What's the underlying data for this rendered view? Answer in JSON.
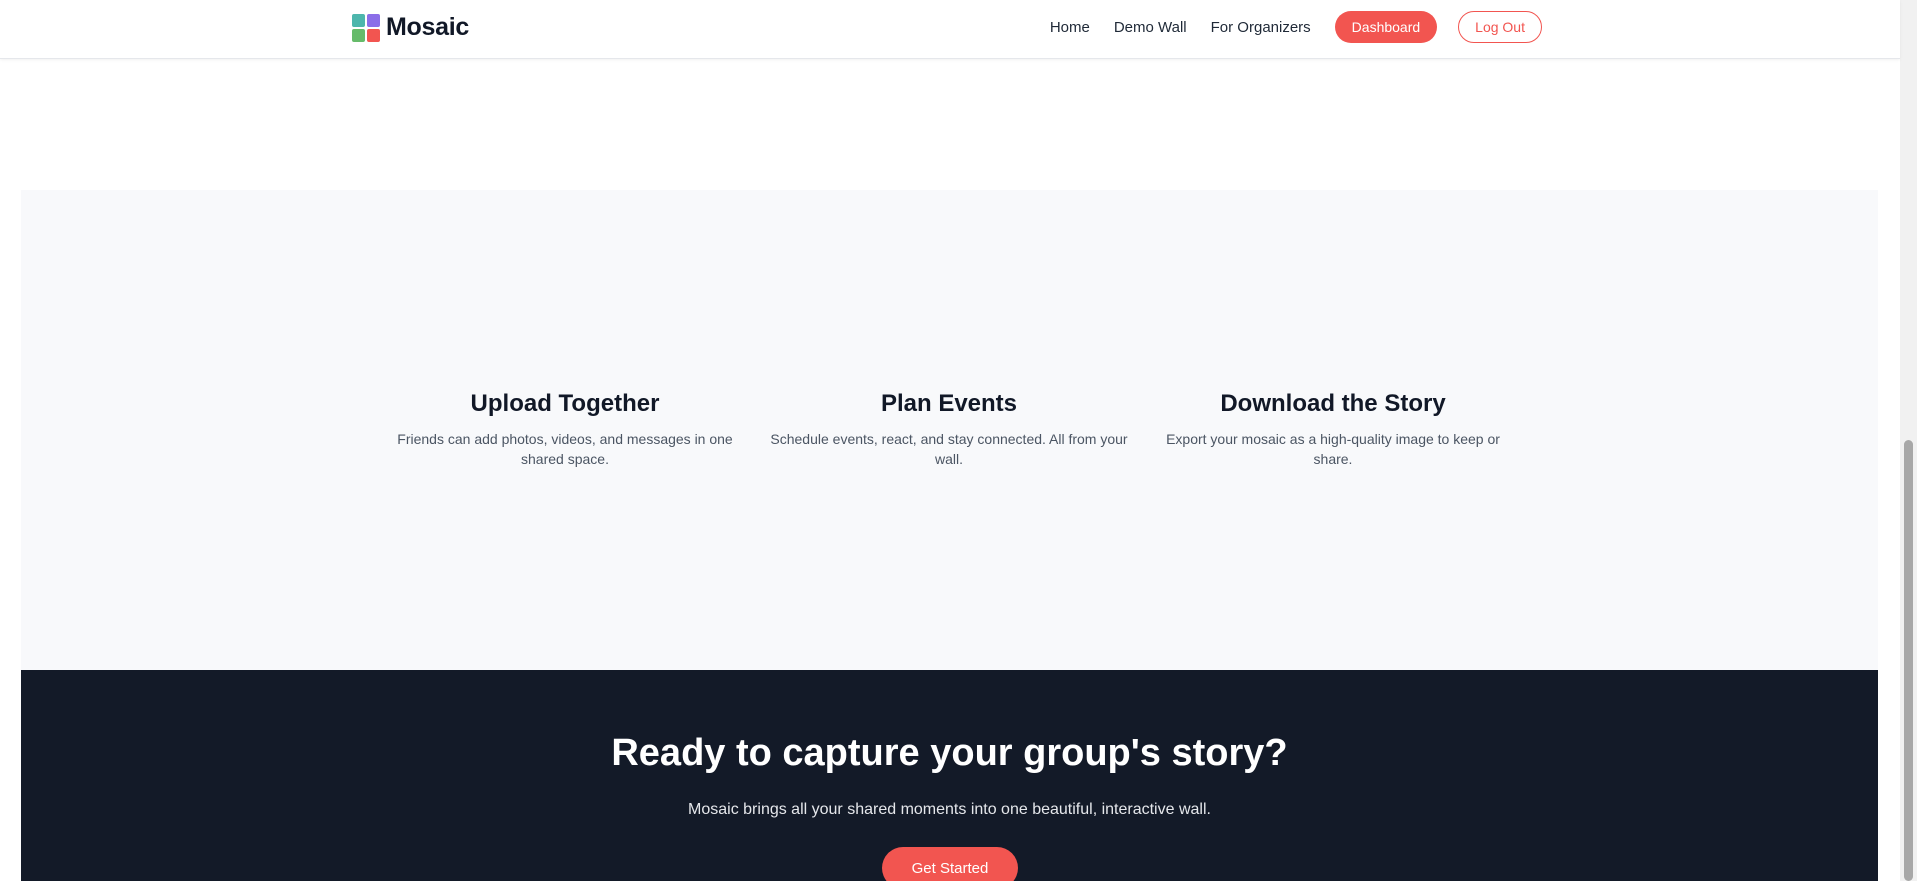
{
  "header": {
    "logo_text": "Mosaic",
    "logo_colors": [
      "#4db6ac",
      "#8b6ee8",
      "#66bb6a",
      "#f25550"
    ],
    "nav": {
      "home": "Home",
      "demo_wall": "Demo Wall",
      "for_organizers": "For Organizers",
      "dashboard": "Dashboard",
      "log_out": "Log Out"
    }
  },
  "features": [
    {
      "title": "Upload Together",
      "description": "Friends can add photos, videos, and messages in one shared space."
    },
    {
      "title": "Plan Events",
      "description": "Schedule events, react, and stay connected. All from your wall."
    },
    {
      "title": "Download the Story",
      "description": "Export your mosaic as a high-quality image to keep or share."
    }
  ],
  "cta": {
    "title": "Ready to capture your group's story?",
    "subtitle": "Mosaic brings all your shared moments into one beautiful, interactive wall.",
    "button": "Get Started"
  },
  "colors": {
    "accent": "#f25550",
    "dark_bg": "#131a28",
    "features_bg": "#f8f9fb"
  }
}
